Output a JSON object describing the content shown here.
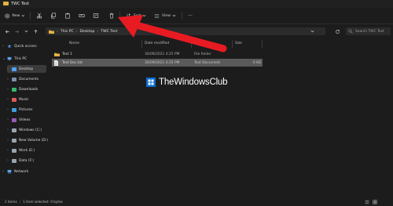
{
  "window": {
    "title": "TWC Test"
  },
  "toolbar": {
    "new_label": "New",
    "sort_label": "Sort",
    "view_label": "View",
    "more_label": "···"
  },
  "address": {
    "crumbs": [
      "This PC",
      "Desktop",
      "TWC Test"
    ]
  },
  "search": {
    "placeholder": "Search TWC Test"
  },
  "nav_pane": {
    "items": [
      {
        "label": "Quick access",
        "icon": "star-icon",
        "color": "#4a90e2"
      },
      {
        "label": "This PC",
        "icon": "pc-icon",
        "color": "#5aa0e6"
      },
      {
        "label": "Desktop",
        "icon": "desktop-icon",
        "color": "#4da3ff"
      },
      {
        "label": "Documents",
        "icon": "documents-icon",
        "color": "#7a8fa6"
      },
      {
        "label": "Downloads",
        "icon": "downloads-icon",
        "color": "#39b86a"
      },
      {
        "label": "Music",
        "icon": "music-icon",
        "color": "#e05a5a"
      },
      {
        "label": "Pictures",
        "icon": "pictures-icon",
        "color": "#3f9fdc"
      },
      {
        "label": "Videos",
        "icon": "videos-icon",
        "color": "#9b59b6"
      },
      {
        "label": "Windows (C:)",
        "icon": "drive-icon",
        "color": "#9aa4ad"
      },
      {
        "label": "New Volume (D:)",
        "icon": "drive-icon",
        "color": "#9aa4ad"
      },
      {
        "label": "Work (E:)",
        "icon": "drive-icon",
        "color": "#9aa4ad"
      },
      {
        "label": "Data (F:)",
        "icon": "drive-icon",
        "color": "#9aa4ad"
      },
      {
        "label": "Network",
        "icon": "network-icon",
        "color": "#5aa0e6"
      }
    ]
  },
  "file_list": {
    "columns": [
      "Name",
      "Date modified",
      "Type",
      "Size"
    ],
    "rows": [
      {
        "name": "Test 1",
        "date": "30/09/2021 4:25 PM",
        "type": "File folder",
        "size": ""
      },
      {
        "name": "Test Doc.txt",
        "date": "30/09/2021 4:25 PM",
        "type": "Text Document",
        "size": "0 KB"
      }
    ]
  },
  "watermark": {
    "text": "TheWindowsClub"
  },
  "status": {
    "item_count": "2 items",
    "selection": "1 item selected  0 bytes"
  },
  "colors": {
    "accent": "#0a6ed1",
    "arrow": "#e81b23",
    "folder": "#e3b341"
  }
}
